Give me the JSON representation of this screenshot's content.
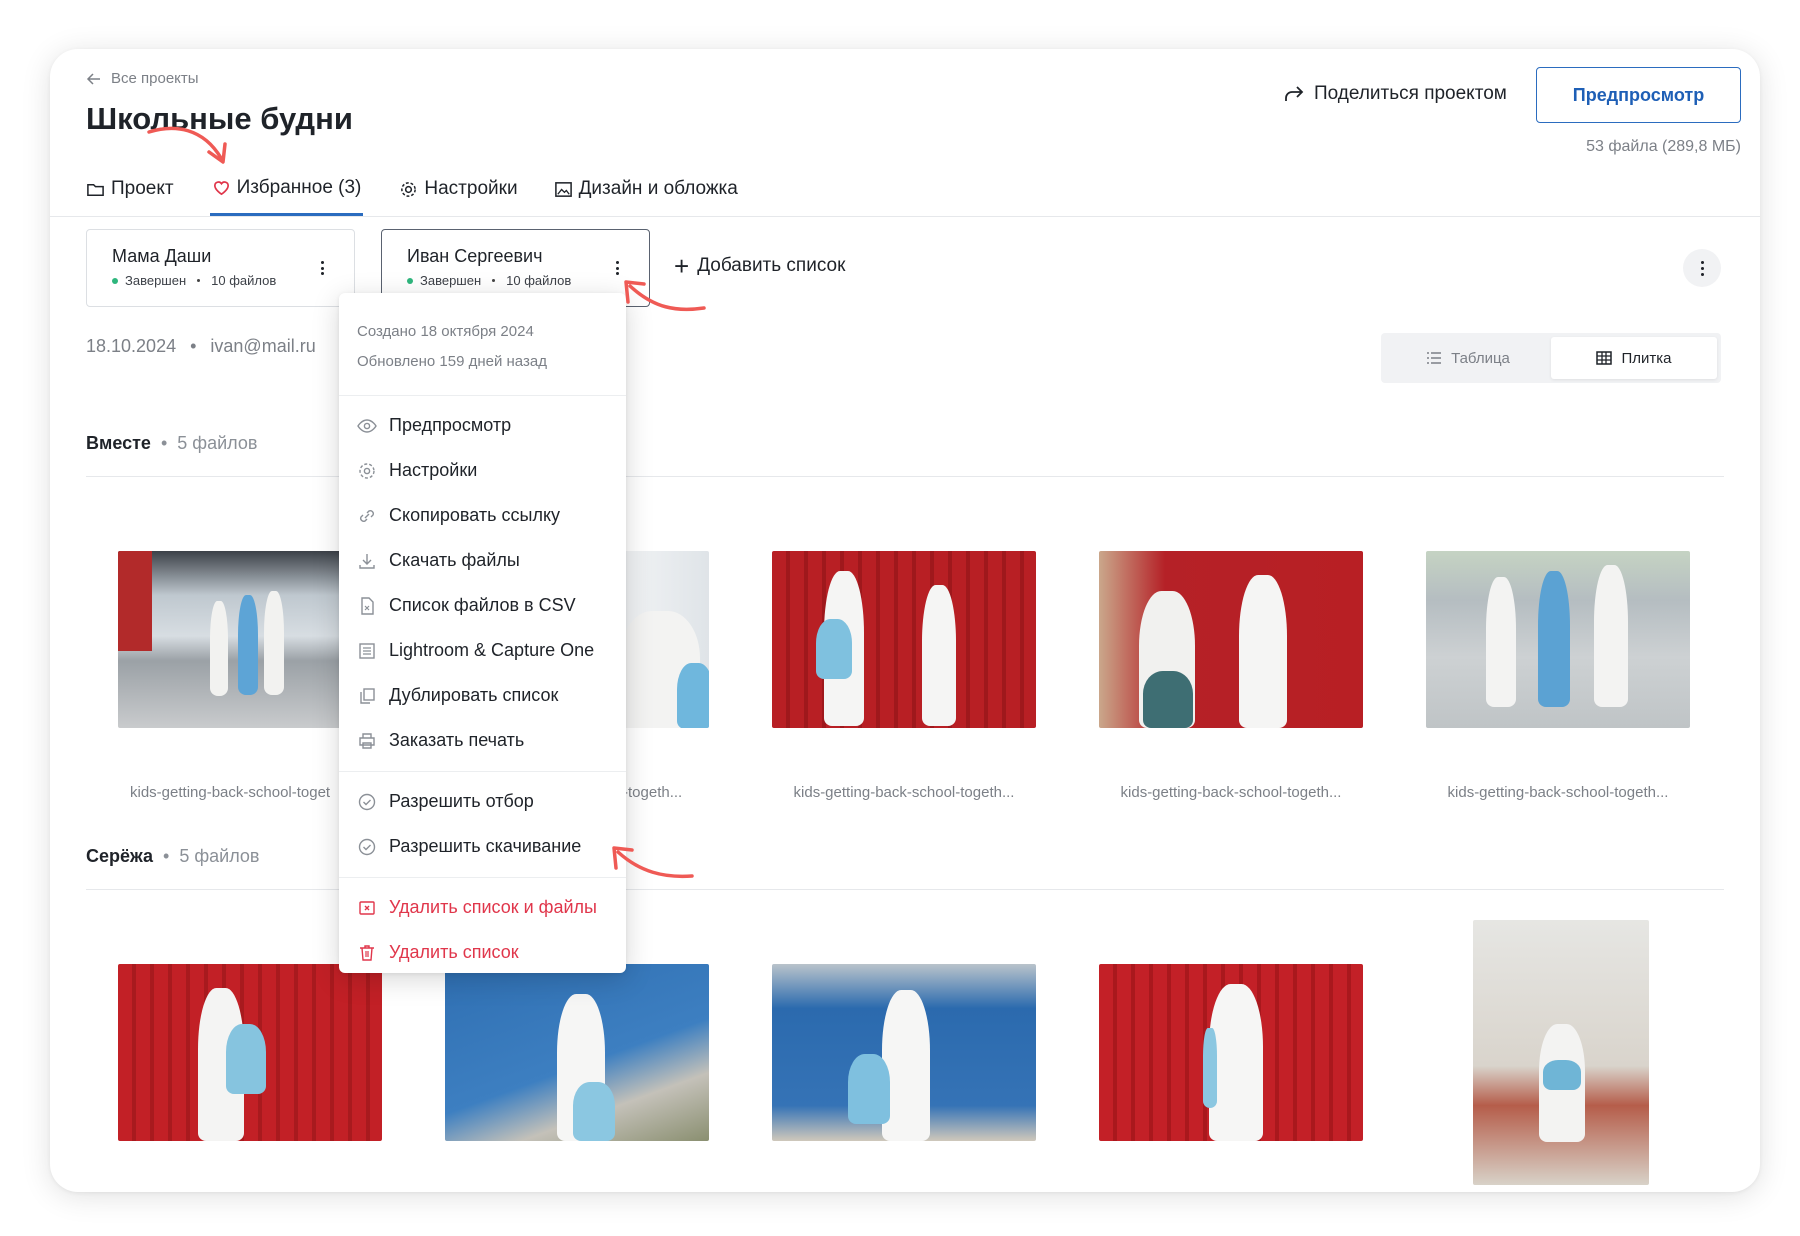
{
  "header": {
    "back_label": "Все проекты",
    "title": "Школьные будни",
    "share_label": "Поделиться проектом",
    "preview_label": "Предпросмотр",
    "file_count": "53 файла (289,8 МБ)"
  },
  "tabs": [
    {
      "label": "Проект",
      "icon": "folder-icon"
    },
    {
      "label": "Избранное (3)",
      "icon": "heart-icon"
    },
    {
      "label": "Настройки",
      "icon": "gear-icon"
    },
    {
      "label": "Дизайн и обложка",
      "icon": "image-icon"
    }
  ],
  "lists": [
    {
      "name": "Мама Даши",
      "status": "Завершен",
      "files": "10 файлов"
    },
    {
      "name": "Иван Сергеевич",
      "status": "Завершен",
      "files": "10 файлов"
    }
  ],
  "add_list_label": "Добавить список",
  "info": {
    "date": "18.10.2024",
    "email": "ivan@mail.ru"
  },
  "view": {
    "table": "Таблица",
    "tiles": "Плитка"
  },
  "sections": [
    {
      "title": "Вместе",
      "count": "5 файлов",
      "captions": [
        "kids-getting-back-school-toget",
        "-togeth...",
        "kids-getting-back-school-togeth...",
        "kids-getting-back-school-togeth...",
        "kids-getting-back-school-togeth..."
      ]
    },
    {
      "title": "Серёжа",
      "count": "5 файлов"
    }
  ],
  "menu": {
    "created": "Создано 18 октября 2024",
    "updated": "Обновлено 159 дней назад",
    "items": [
      {
        "label": "Предпросмотр",
        "icon": "eye-icon"
      },
      {
        "label": "Настройки",
        "icon": "gear-icon"
      },
      {
        "label": "Скопировать ссылку",
        "icon": "link-icon"
      },
      {
        "label": "Скачать файлы",
        "icon": "download-icon"
      },
      {
        "label": "Список файлов в CSV",
        "icon": "csv-file-icon"
      },
      {
        "label": "Lightroom & Capture One",
        "icon": "list-icon"
      },
      {
        "label": "Дублировать список",
        "icon": "duplicate-icon"
      },
      {
        "label": "Заказать печать",
        "icon": "printer-icon"
      }
    ],
    "toggles": [
      {
        "label": "Разрешить отбор",
        "icon": "check-circle-icon"
      },
      {
        "label": "Разрешить скачивание",
        "icon": "check-circle-icon"
      }
    ],
    "danger": [
      {
        "label": "Удалить список и файлы",
        "icon": "delete-files-icon"
      },
      {
        "label": "Удалить список",
        "icon": "trash-icon"
      }
    ]
  },
  "colors": {
    "accent": "#2b6cbf",
    "danger": "#e0364b",
    "status_green": "#2eb67d",
    "annotation": "#ef5a55"
  }
}
